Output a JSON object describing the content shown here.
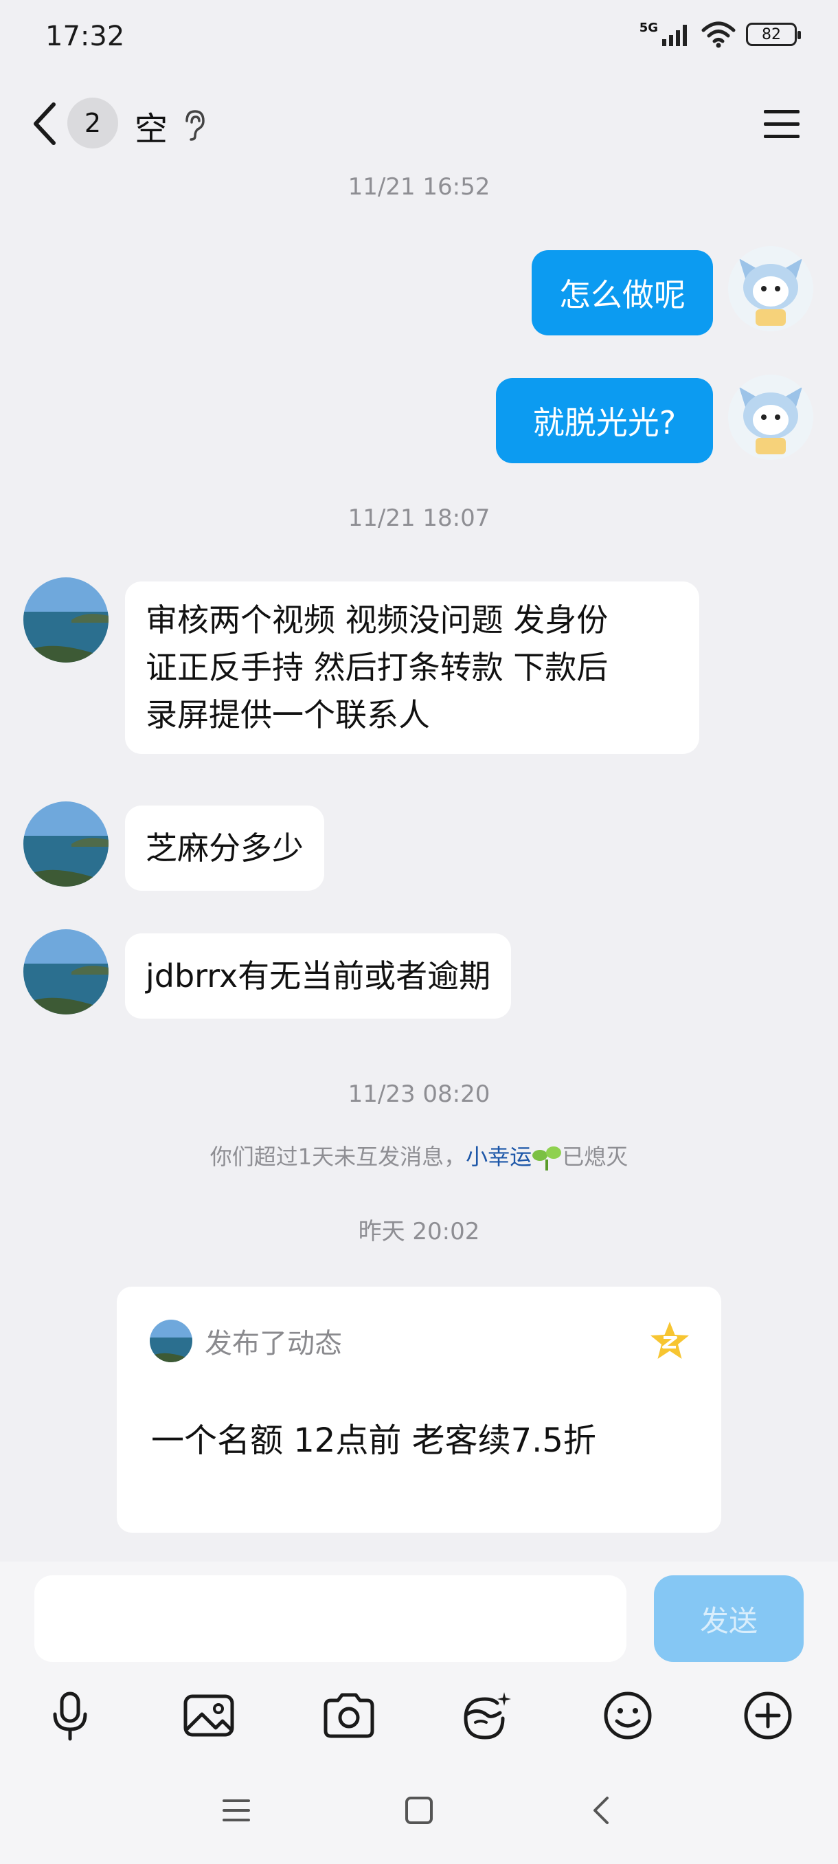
{
  "status_bar": {
    "time": "17:32",
    "network": "5G",
    "battery": "82"
  },
  "header": {
    "unread_count": "2",
    "title": "空"
  },
  "messages": {
    "ts1": "11/21 16:52",
    "out1": "怎么做呢",
    "out2": "就脱光光?",
    "ts2": "11/21 18:07",
    "in1_lines": [
      "审核两个视频 视频没问题 发身份",
      "证正反手持 然后打条转款 下款后",
      "录屏提供一个联系人"
    ],
    "in2": "芝麻分多少",
    "in3": "jdbrrx有无当前或者逾期",
    "ts3": "11/23 08:20",
    "system_note": {
      "before": "你们超过1天未互发消息，",
      "link": "小幸运",
      "after": "已熄灭"
    },
    "ts4": "昨天 20:02"
  },
  "post_card": {
    "label": "发布了动态",
    "text": "一个名额 12点前 老客续7.5折"
  },
  "input_bar": {
    "placeholder": "",
    "send_label": "发送"
  },
  "colors": {
    "outgoing_bubble": "#0c9bf1",
    "send_disabled": "#85c7f4",
    "link": "#1d57a8"
  },
  "icons": {
    "toolbar": [
      "microphone-icon",
      "image-icon",
      "camera-icon",
      "face-filter-icon",
      "emoji-icon",
      "plus-icon"
    ],
    "nav": [
      "menu-nav-icon",
      "home-nav-icon",
      "back-nav-icon"
    ]
  }
}
